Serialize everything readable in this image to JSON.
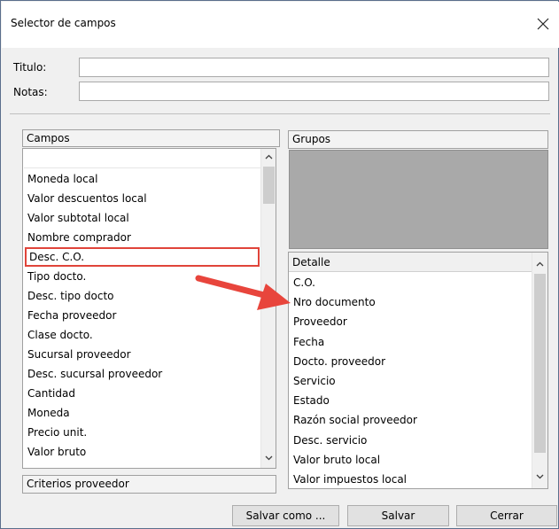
{
  "window": {
    "title": "Selector de campos"
  },
  "form": {
    "titulo_label": "Titulo:",
    "notas_label": "Notas:",
    "titulo_value": "",
    "notas_value": ""
  },
  "campos": {
    "header": "Campos",
    "items": [
      "Moneda local",
      "Valor descuentos local",
      "Valor subtotal local",
      "Nombre comprador",
      "Desc. C.O.",
      "Tipo docto.",
      "Desc. tipo docto",
      "Fecha proveedor",
      "Clase docto.",
      "Sucursal proveedor",
      "Desc. sucursal proveedor",
      "Cantidad",
      "Moneda",
      "Precio unit.",
      "Valor bruto"
    ],
    "highlighted": "Desc. C.O.",
    "footer": "Criterios proveedor"
  },
  "grupos": {
    "header": "Grupos"
  },
  "detalle": {
    "header": "Detalle",
    "items": [
      "C.O.",
      "Nro documento",
      "Proveedor",
      "Fecha",
      "Docto. proveedor",
      "Servicio",
      "Estado",
      "Razón social proveedor",
      "Desc. servicio",
      "Valor bruto local",
      "Valor impuestos local"
    ]
  },
  "buttons": {
    "save_as": "Salvar como ...",
    "save": "Salvar",
    "close": "Cerrar"
  },
  "colors": {
    "highlight": "#e0443a",
    "arrow": "#e8453c",
    "group_bg": "#a9a9a9"
  },
  "icons": {
    "close": "close-icon",
    "scroll_up": "chevron-up-icon",
    "scroll_down": "chevron-down-icon",
    "annotation": "arrow-right-icon"
  }
}
